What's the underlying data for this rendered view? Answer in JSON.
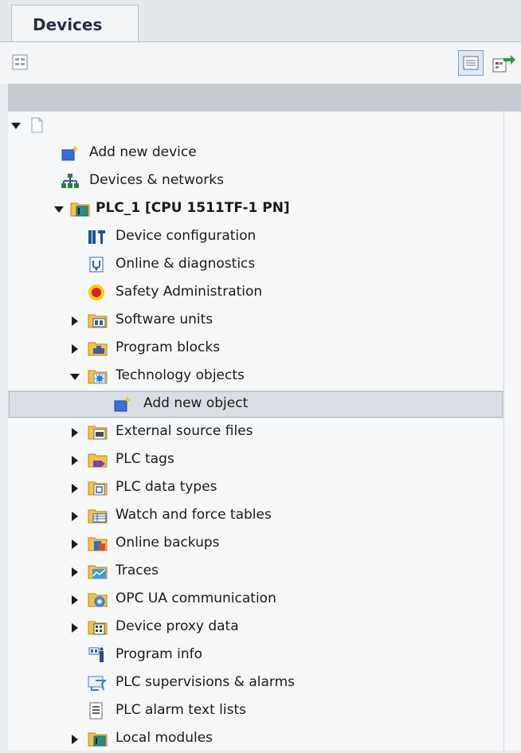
{
  "tab": {
    "label": "Devices"
  },
  "toolbar": {
    "left_icon": "tree-view-icon",
    "right_icons": [
      "details-view-icon",
      "export-icon"
    ]
  },
  "tree": {
    "root_icon": "project-icon",
    "items": [
      {
        "label": "Add new device",
        "icon": "add-device-icon"
      },
      {
        "label": "Devices & networks",
        "icon": "network-icon"
      },
      {
        "label": "PLC_1 [CPU 1511TF-1 PN]",
        "icon": "plc-folder-icon"
      },
      {
        "label": "Device configuration",
        "icon": "device-configuration-icon"
      },
      {
        "label": "Online & diagnostics",
        "icon": "diagnostics-icon"
      },
      {
        "label": "Safety Administration",
        "icon": "safety-icon"
      },
      {
        "label": "Software units",
        "icon": "software-units-folder-icon"
      },
      {
        "label": "Program blocks",
        "icon": "program-blocks-folder-icon"
      },
      {
        "label": "Technology objects",
        "icon": "technology-objects-folder-icon"
      },
      {
        "label": "Add new object",
        "icon": "add-object-icon"
      },
      {
        "label": "External source files",
        "icon": "source-files-folder-icon"
      },
      {
        "label": "PLC tags",
        "icon": "plc-tags-folder-icon"
      },
      {
        "label": "PLC data types",
        "icon": "data-types-folder-icon"
      },
      {
        "label": "Watch and force tables",
        "icon": "watch-tables-folder-icon"
      },
      {
        "label": "Online backups",
        "icon": "backups-folder-icon"
      },
      {
        "label": "Traces",
        "icon": "traces-folder-icon"
      },
      {
        "label": "OPC UA communication",
        "icon": "opc-ua-folder-icon"
      },
      {
        "label": "Device proxy data",
        "icon": "proxy-data-folder-icon"
      },
      {
        "label": "Program info",
        "icon": "program-info-icon"
      },
      {
        "label": "PLC supervisions & alarms",
        "icon": "supervisions-icon"
      },
      {
        "label": "PLC alarm text lists",
        "icon": "text-lists-icon"
      },
      {
        "label": "Local modules",
        "icon": "local-modules-folder-icon"
      }
    ]
  }
}
